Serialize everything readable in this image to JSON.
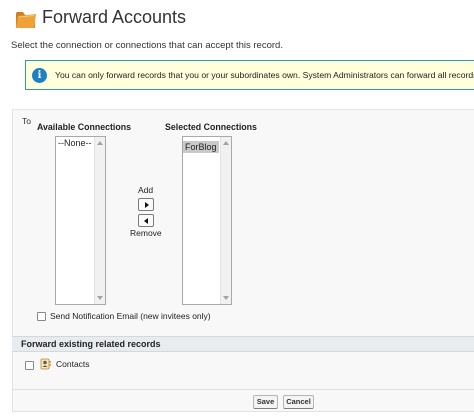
{
  "header": {
    "title": "Forward Accounts",
    "subtitle": "Select the connection or connections that can accept this record."
  },
  "info_banner": {
    "icon": "info-icon",
    "text": "You can only forward records that you or your subordinates own. System Administrators can forward all records."
  },
  "form": {
    "to_label": "To",
    "available": {
      "label": "Available Connections",
      "options": [
        "--None--"
      ]
    },
    "selected": {
      "label": "Selected Connections",
      "options": [
        "ForBlog"
      ]
    },
    "add_label": "Add",
    "remove_label": "Remove",
    "notification_label": "Send Notification Email (new invitees only)",
    "notification_checked": false
  },
  "related": {
    "title": "Forward existing related records",
    "items": [
      {
        "label": "Contacts",
        "icon": "contacts-icon",
        "checked": false
      }
    ]
  },
  "footer": {
    "save_label": "Save",
    "cancel_label": "Cancel"
  },
  "colors": {
    "banner_bg": "#ffffdc",
    "banner_border": "#3399aa",
    "info_icon": "#1f7fc4",
    "folder": "#f0a23a"
  }
}
